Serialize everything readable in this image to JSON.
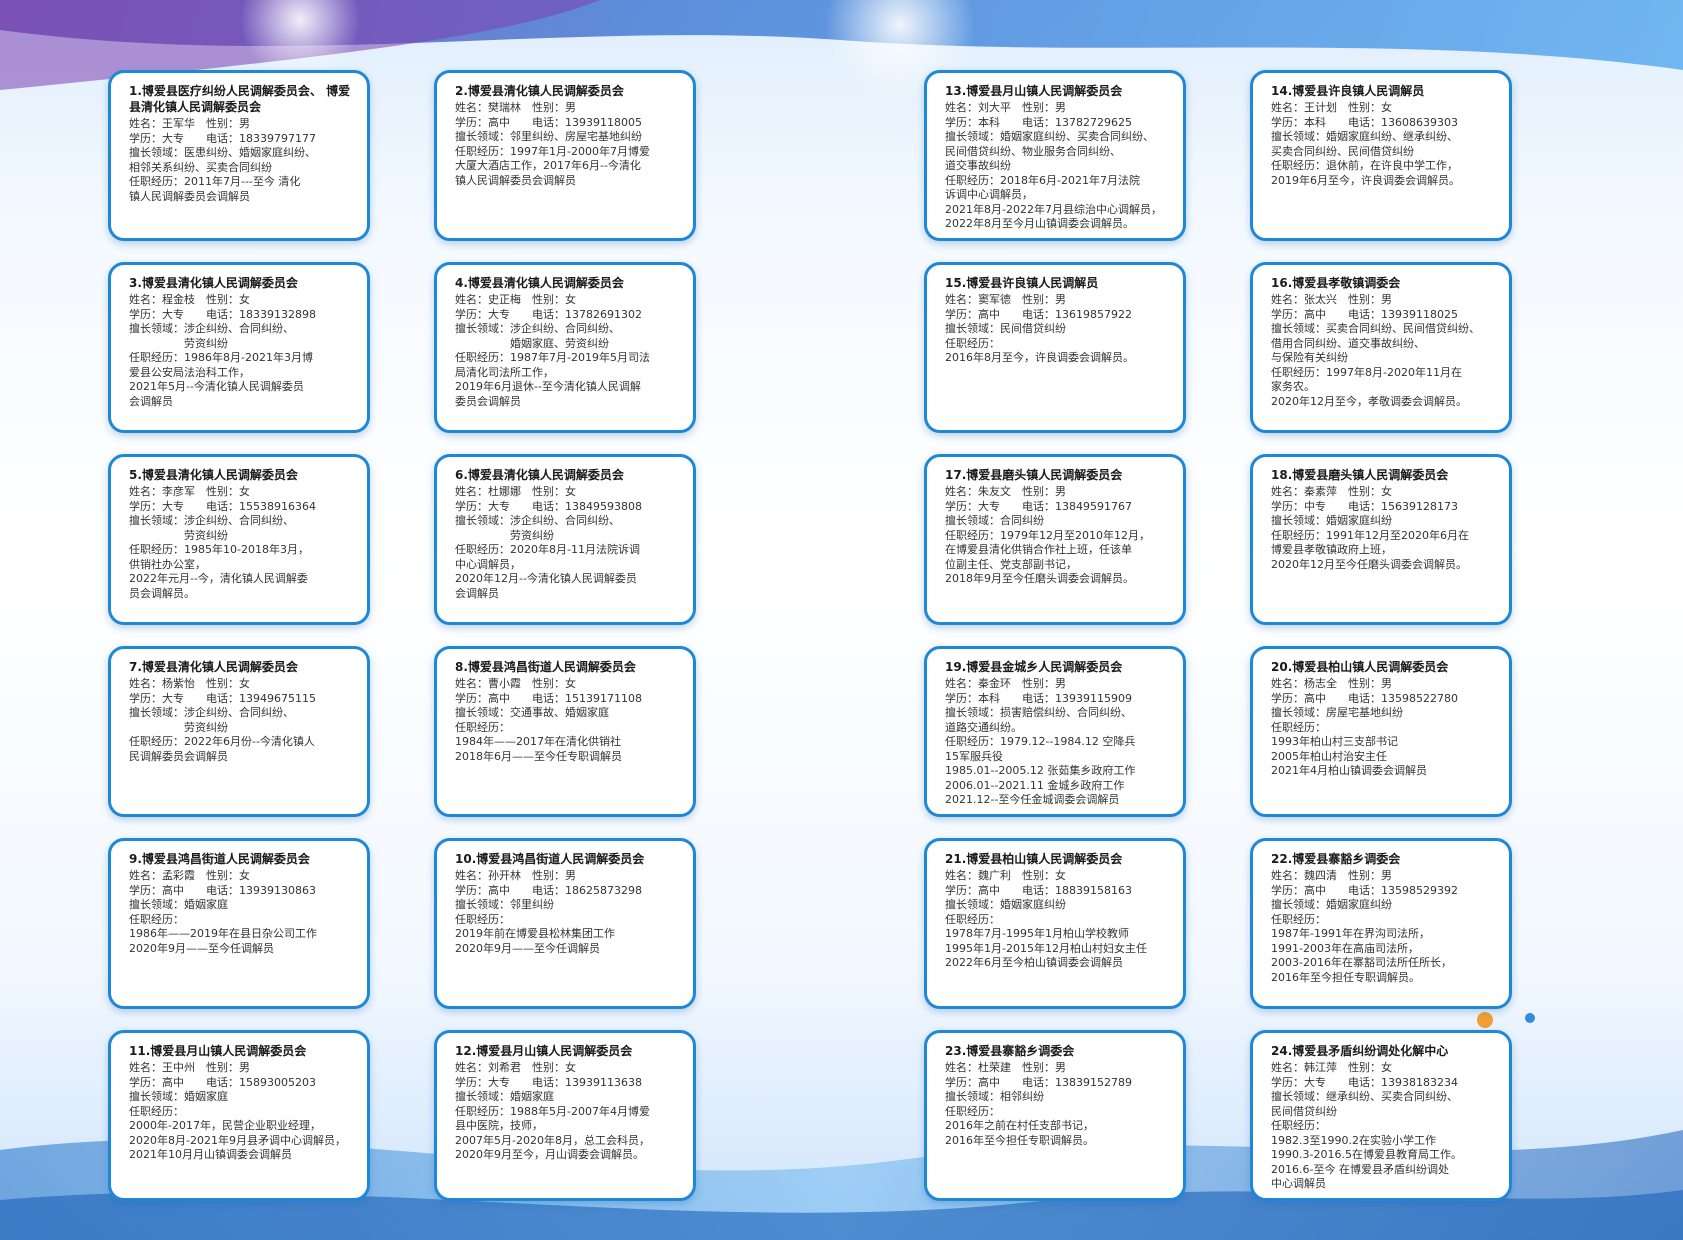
{
  "colors": {
    "card_border": "#1e88d8",
    "wave_dark": "#1c70c8",
    "wave_light": "#6fb8f0",
    "accent_orange": "#f0a030"
  },
  "cards": [
    {
      "title": "1.博爱县医疗纠纷人民调解委员会、\n博爱县清化镇人民调解委员会",
      "body": "姓名：王军华　性别：男\n学历：大专　　电话：18339797177\n擅长领域：医患纠纷、婚姻家庭纠纷、\n相邻关系纠纷、买卖合同纠纷\n任职经历：2011年7月---至今 清化\n镇人民调解委员会调解员"
    },
    {
      "title": "2.博爱县清化镇人民调解委员会",
      "body": "姓名：樊瑞林　性别：男\n学历：高中　　电话：13939118005\n擅长领域：邻里纠纷、房屋宅基地纠纷\n任职经历：1997年1月-2000年7月博爱\n大厦大酒店工作，2017年6月--今清化\n镇人民调解委员会调解员"
    },
    {
      "title": "3.博爱县清化镇人民调解委员会",
      "body": "姓名：程金枝　性别：女\n学历：大专　　电话：18339132898\n擅长领域：涉企纠纷、合同纠纷、\n　　　　　劳资纠纷\n任职经历：1986年8月-2021年3月博\n爱县公安局法治科工作，\n2021年5月--今清化镇人民调解委员\n会调解员"
    },
    {
      "title": "4.博爱县清化镇人民调解委员会",
      "body": "姓名：史正梅　性别：女\n学历：大专　　电话：13782691302\n擅长领域：涉企纠纷、合同纠纷、\n　　　　　婚姻家庭、劳资纠纷\n任职经历：1987年7月-2019年5月司法\n局清化司法所工作，\n2019年6月退休--至今清化镇人民调解\n委员会调解员"
    },
    {
      "title": "5.博爱县清化镇人民调解委员会",
      "body": "姓名：李彦军　性别：女\n学历：大专　　电话：15538916364\n擅长领域：涉企纠纷、合同纠纷、\n　　　　　劳资纠纷\n任职经历：1985年10-2018年3月，\n供销社办公室，\n2022年元月--今，清化镇人民调解委\n员会调解员。"
    },
    {
      "title": "6.博爱县清化镇人民调解委员会",
      "body": "姓名：杜娜娜　性别：女\n学历：大专　　电话：13849593808\n擅长领域：涉企纠纷、合同纠纷、\n　　　　　劳资纠纷\n任职经历：2020年8月-11月法院诉调\n中心调解员，\n2020年12月--今清化镇人民调解委员\n会调解员"
    },
    {
      "title": "7.博爱县清化镇人民调解委员会",
      "body": "姓名：杨紫怡　性别：女\n学历：大专　　电话：13949675115\n擅长领域：涉企纠纷、合同纠纷、\n　　　　　劳资纠纷\n任职经历：2022年6月份--今清化镇人\n民调解委员会调解员"
    },
    {
      "title": "8.博爱县鸿昌街道人民调解委员会",
      "body": "姓名：曹小霞　性别：女\n学历：高中　　电话：15139171108\n擅长领域：交通事故、婚姻家庭\n任职经历：\n1984年——2017年在清化供销社\n2018年6月——至今任专职调解员"
    },
    {
      "title": "9.博爱县鸿昌街道人民调解委员会",
      "body": "姓名：孟彩霞　性别：女\n学历：高中　　电话：13939130863\n擅长领域：婚姻家庭\n任职经历：\n1986年——2019年在县日杂公司工作\n2020年9月——至今任调解员"
    },
    {
      "title": "10.博爱县鸿昌街道人民调解委员会",
      "body": "姓名：孙开林　性别：男\n学历：高中　　电话：18625873298\n擅长领域：邻里纠纷\n任职经历：\n2019年前在博爱县松林集团工作\n2020年9月——至今任调解员"
    },
    {
      "title": "11.博爱县月山镇人民调解委员会",
      "body": "姓名：王中州　性别：男\n学历：高中　　电话：15893005203\n擅长领域：婚姻家庭\n任职经历：\n2000年-2017年，民营企业职业经理，\n2020年8月-2021年9月县矛调中心调解员，\n2021年10月月山镇调委会调解员"
    },
    {
      "title": "12.博爱县月山镇人民调解委员会",
      "body": "姓名：刘希君　性别：女\n学历：大专　　电话：13939113638\n擅长领域：婚姻家庭\n任职经历：1988年5月-2007年4月博爱\n县中医院，技师，\n2007年5月-2020年8月，总工会科员，\n2020年9月至今，月山调委会调解员。"
    },
    {
      "title": "13.博爱县月山镇人民调解委员会",
      "body": "姓名：刘大平　性别：男\n学历：本科　　电话：13782729625\n擅长领域：婚姻家庭纠纷、买卖合同纠纷、\n民间借贷纠纷、物业服务合同纠纷、\n道交事故纠纷\n任职经历：2018年6月-2021年7月法院\n诉调中心调解员，\n2021年8月-2022年7月县综治中心调解员，\n2022年8月至今月山镇调委会调解员。"
    },
    {
      "title": "14.博爱县许良镇人民调解员",
      "body": "姓名：王计划　性别：女\n学历：本科　　电话：13608639303\n擅长领域：婚姻家庭纠纷、继承纠纷、\n买卖合同纠纷、民间借贷纠纷\n任职经历：退休前，在许良中学工作，\n2019年6月至今，许良调委会调解员。"
    },
    {
      "title": "15.博爱县许良镇人民调解员",
      "body": "姓名：窦军德　性别：男\n学历：高中　　电话：13619857922\n擅长领域：民间借贷纠纷\n任职经历：\n2016年8月至今，许良调委会调解员。"
    },
    {
      "title": "16.博爱县孝敬镇调委会",
      "body": "姓名：张太兴　性别：男\n学历：高中　　电话：13939118025\n擅长领域：买卖合同纠纷、民间借贷纠纷、\n借用合同纠纷、道交事故纠纷、\n与保险有关纠纷\n任职经历：1997年8月-2020年11月在\n家务农。\n2020年12月至今，孝敬调委会调解员。"
    },
    {
      "title": "17.博爱县磨头镇人民调解委员会",
      "body": "姓名：朱友文　性别：男\n学历：大专　　电话：13849591767\n擅长领域：合同纠纷\n任职经历：1979年12月至2010年12月，\n在博爱县清化供销合作社上班，任该单\n位副主任、党支部副书记，\n2018年9月至今任磨头调委会调解员。"
    },
    {
      "title": "18.博爱县磨头镇人民调解委员会",
      "body": "姓名：秦素萍　性别：女\n学历：中专　　电话：15639128173\n擅长领域：婚姻家庭纠纷\n任职经历：1991年12月至2020年6月在\n博爱县孝敬镇政府上班，\n2020年12月至今任磨头调委会调解员。"
    },
    {
      "title": "19.博爱县金城乡人民调解委员会",
      "body": "姓名：秦金环　性别：男\n学历：本科　　电话：13939115909\n擅长领域：损害赔偿纠纷、合同纠纷、\n道路交通纠纷。\n任职经历：1979.12--1984.12 空降兵\n15军服兵役\n1985.01--2005.12 张茹集乡政府工作\n2006.01--2021.11 金城乡政府工作\n2021.12--至今任金城调委会调解员"
    },
    {
      "title": "20.博爱县柏山镇人民调解委员会",
      "body": "姓名：杨志全　性别：男\n学历：高中　　电话：13598522780\n擅长领域：房屋宅基地纠纷\n任职经历：\n1993年柏山村三支部书记\n2005年柏山村治安主任\n2021年4月柏山镇调委会调解员"
    },
    {
      "title": "21.博爱县柏山镇人民调解委员会",
      "body": "姓名：魏广利　性别：女\n学历：高中　　电话：18839158163\n擅长领域：婚姻家庭纠纷\n任职经历：\n1978年7月-1995年1月柏山学校教师\n1995年1月-2015年12月柏山村妇女主任\n2022年6月至今柏山镇调委会调解员"
    },
    {
      "title": "22.博爱县寨豁乡调委会",
      "body": "姓名：魏四清　性别：男\n学历：高中　　电话：13598529392\n擅长领域：婚姻家庭纠纷\n任职经历：\n1987年-1991年在界沟司法所，\n1991-2003年在高庙司法所，\n2003-2016年在寨豁司法所任所长，\n2016年至今担任专职调解员。"
    },
    {
      "title": "23.博爱县寨豁乡调委会",
      "body": "姓名：杜荣建　性别：男\n学历：高中　　电话：13839152789\n擅长领域：相邻纠纷\n任职经历：\n2016年之前在村任支部书记，\n2016年至今担任专职调解员。"
    },
    {
      "title": "24.博爱县矛盾纠纷调处化解中心",
      "body": "姓名：韩江萍　性别：女\n学历：大专　　电话：13938183234\n擅长领域：继承纠纷、买卖合同纠纷、\n民间借贷纠纷\n任职经历：\n1982.3至1990.2在实验小学工作\n1990.3-2016.5在博爱县教育局工作。\n2016.6-至今 在博爱县矛盾纠纷调处\n中心调解员"
    }
  ]
}
